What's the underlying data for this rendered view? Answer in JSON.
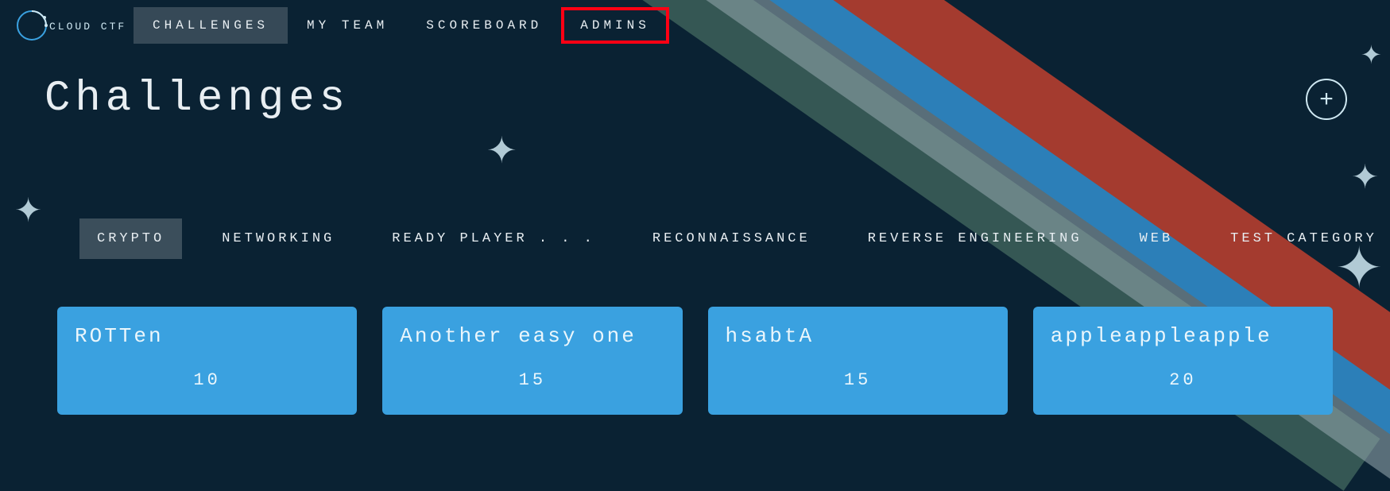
{
  "brand": {
    "name": "CLOUD CTF"
  },
  "nav": {
    "items": [
      {
        "label": "CHALLENGES",
        "active": true
      },
      {
        "label": "MY TEAM",
        "active": false
      },
      {
        "label": "SCOREBOARD",
        "active": false
      },
      {
        "label": "ADMINS",
        "active": false,
        "highlighted": true
      }
    ]
  },
  "page": {
    "title": "Challenges",
    "add_label": "+"
  },
  "categories": [
    {
      "label": "CRYPTO",
      "active": true
    },
    {
      "label": "NETWORKING"
    },
    {
      "label": "READY PLAYER . . ."
    },
    {
      "label": "RECONNAISSANCE"
    },
    {
      "label": "REVERSE ENGINEERING"
    },
    {
      "label": "WEB"
    },
    {
      "label": "TEST CATEGORY"
    }
  ],
  "challenges": [
    {
      "title": "ROTTen",
      "points": "10"
    },
    {
      "title": "Another easy one",
      "points": "15"
    },
    {
      "title": "hsabtA",
      "points": "15"
    },
    {
      "title": "appleappleapple",
      "points": "20"
    }
  ],
  "colors": {
    "bg": "#0a2233",
    "card": "#3aa1e0",
    "highlight": "#ff0014"
  }
}
